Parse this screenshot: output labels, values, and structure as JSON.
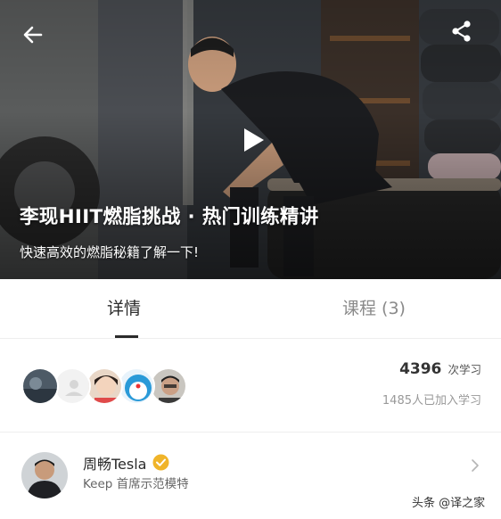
{
  "hero": {
    "title": "李现HIIT燃脂挑战 · 热门训练精讲",
    "subtitle": "快速高效的燃脂秘籍了解一下!",
    "back_icon": "arrow-left-icon",
    "share_icon": "share-icon",
    "play_icon": "play-icon"
  },
  "tabs": [
    {
      "label": "详情",
      "active": true
    },
    {
      "label": "课程 (3)",
      "active": false
    }
  ],
  "stats": {
    "learn_count": "4396",
    "learn_unit": "次学习",
    "joined_text": "1485人已加入学习"
  },
  "coach": {
    "name": "周畅Tesla",
    "title": "Keep 首席示范模特",
    "badge_icon": "verified-badge-icon",
    "chevron_icon": "chevron-right-icon"
  },
  "watermark": "头条 @译之家",
  "colors": {
    "badge": "#f0b429",
    "text_primary": "#2b2b2b",
    "text_secondary": "#999999"
  }
}
